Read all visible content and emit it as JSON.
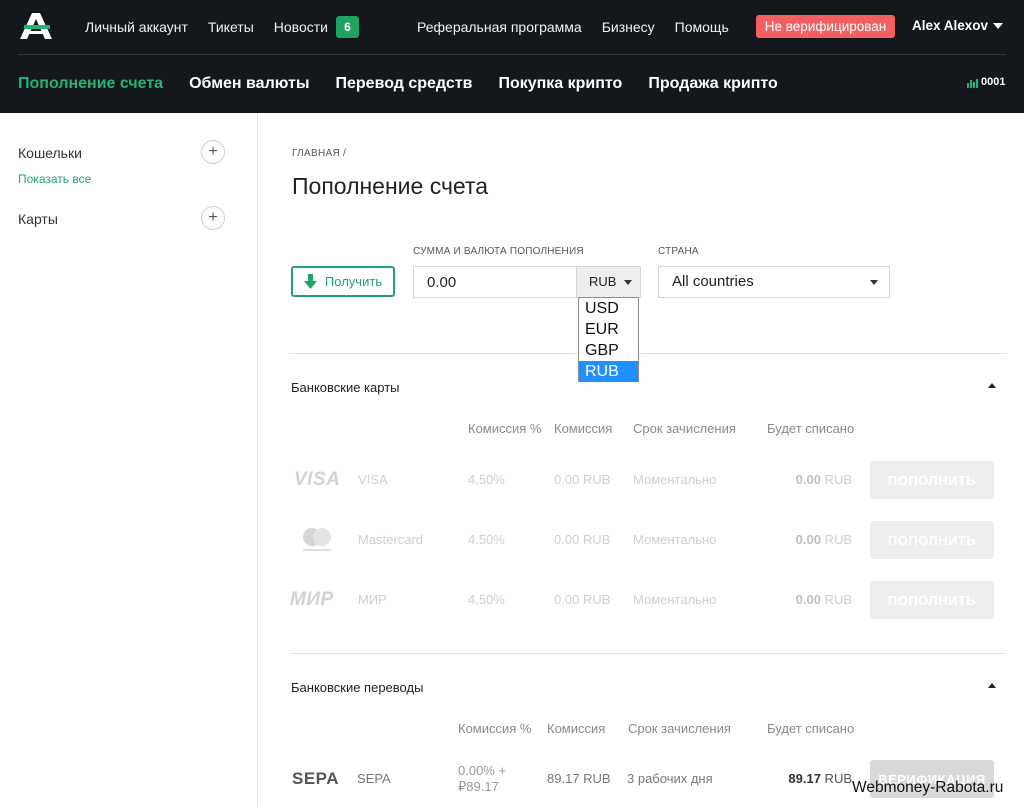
{
  "header": {
    "left_nav": [
      {
        "label": "Личный аккаунт"
      },
      {
        "label": "Тикеты"
      },
      {
        "label": "Новости",
        "badge": "6"
      }
    ],
    "right_nav": [
      {
        "label": "Реферальная программа"
      },
      {
        "label": "Бизнесу"
      },
      {
        "label": "Помощь"
      }
    ],
    "verification_badge": "Не верифицирован",
    "user_name": "Alex Alexov",
    "sub_nav": [
      {
        "label": "Пополнение счета",
        "active": true
      },
      {
        "label": "Обмен валюты"
      },
      {
        "label": "Перевод средств"
      },
      {
        "label": "Покупка крипто"
      },
      {
        "label": "Продажа крипто"
      }
    ],
    "stat_value": "0001",
    "colors": {
      "background": "#14171c",
      "accent": "#22b573",
      "badge_red": "#f26062"
    }
  },
  "sidebar": {
    "wallets_label": "Кошельки",
    "show_all": "Показать все",
    "cards_label": "Карты",
    "add_symbol": "+"
  },
  "main": {
    "breadcrumb": "ГЛАВНАЯ /",
    "title": "Пополнение счета",
    "get_button": "Получить",
    "amount_label": "СУММА И ВАЛЮТА ПОПОЛНЕНИЯ",
    "amount_value": "0.00",
    "currency_selected": "RUB",
    "currency_options": [
      "USD",
      "EUR",
      "GBP",
      "RUB"
    ],
    "country_label": "СТРАНА",
    "country_value": "All countries"
  },
  "bank_cards": {
    "title": "Банковские карты",
    "columns": [
      "Комиссия %",
      "Комиссия",
      "Срок зачисления",
      "Будет списано"
    ],
    "rows": [
      {
        "logo": "VISA",
        "name": "VISA",
        "fee_pct": "4.50%",
        "fee": "0.00 RUB",
        "term": "Моментально",
        "amount_num": "0.00",
        "amount_cur": " RUB",
        "button": "ПОПОЛНИТЬ"
      },
      {
        "logo": "mastercard-logo",
        "name": "Mastercard",
        "fee_pct": "4.50%",
        "fee": "0.00 RUB",
        "term": "Моментально",
        "amount_num": "0.00",
        "amount_cur": " RUB",
        "button": "ПОПОЛНИТЬ"
      },
      {
        "logo": "МИР",
        "name": "МИР",
        "fee_pct": "4.50%",
        "fee": "0.00 RUB",
        "term": "Моментально",
        "amount_num": "0.00",
        "amount_cur": " RUB",
        "button": "ПОПОЛНИТЬ"
      }
    ]
  },
  "bank_transfers": {
    "title": "Банковские переводы",
    "columns": [
      "Комиссия %",
      "Комиссия",
      "Срок зачисления",
      "Будет списано"
    ],
    "rows": [
      {
        "logo": "SEPA",
        "name": "SEPA",
        "fee_pct_line1": "0.00% +",
        "fee_pct_line2": "₽89.17",
        "fee": "89.17 RUB",
        "term": "3 рабочих дня",
        "amount_num": "89.17",
        "amount_cur": " RUB",
        "button": "ВЕРИФИКАЦИЯ"
      }
    ]
  },
  "watermark": "Webmoney-Rabota.ru"
}
